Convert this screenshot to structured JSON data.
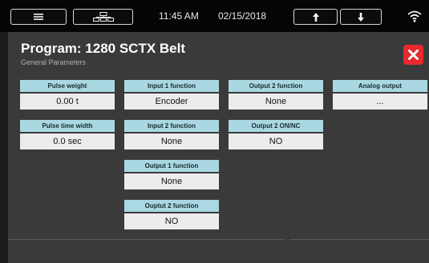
{
  "topbar": {
    "menu_icon": "hamburger-menu-icon",
    "network_icon": "network-icon",
    "time": "11:45 AM",
    "date": "02/15/2018",
    "up_icon": "arrow-up-icon",
    "down_icon": "arrow-down-icon",
    "wifi_icon": "wifi-icon"
  },
  "header": {
    "title": "Program: 1280 SCTX Belt",
    "subtitle": "General Parameters",
    "close_icon": "close-icon"
  },
  "fields": {
    "pulse_weight": {
      "label": "Pulse weight",
      "value": "0.00 t"
    },
    "pulse_time_width": {
      "label": "Pulse time width",
      "value": "0.0 sec"
    },
    "input1_function": {
      "label": "Input 1 function",
      "value": "Encoder"
    },
    "input2_function": {
      "label": "Input 2 function",
      "value": "None"
    },
    "output1_function": {
      "label": "Output 1 function",
      "value": "None"
    },
    "ouptut2_function": {
      "label": "Ouptut 2 function",
      "value": "NO"
    },
    "output2_function": {
      "label": "Output 2 function",
      "value": "None"
    },
    "output2_on_nc": {
      "label": "Output 2 ON/NC",
      "value": "NO"
    },
    "analog_output": {
      "label": "Analog output",
      "value": "..."
    }
  },
  "colors": {
    "label_bg": "#a9d8e2",
    "value_bg": "#ececec",
    "panel_bg": "#3a3a3a",
    "close_red": "#e8292f"
  }
}
